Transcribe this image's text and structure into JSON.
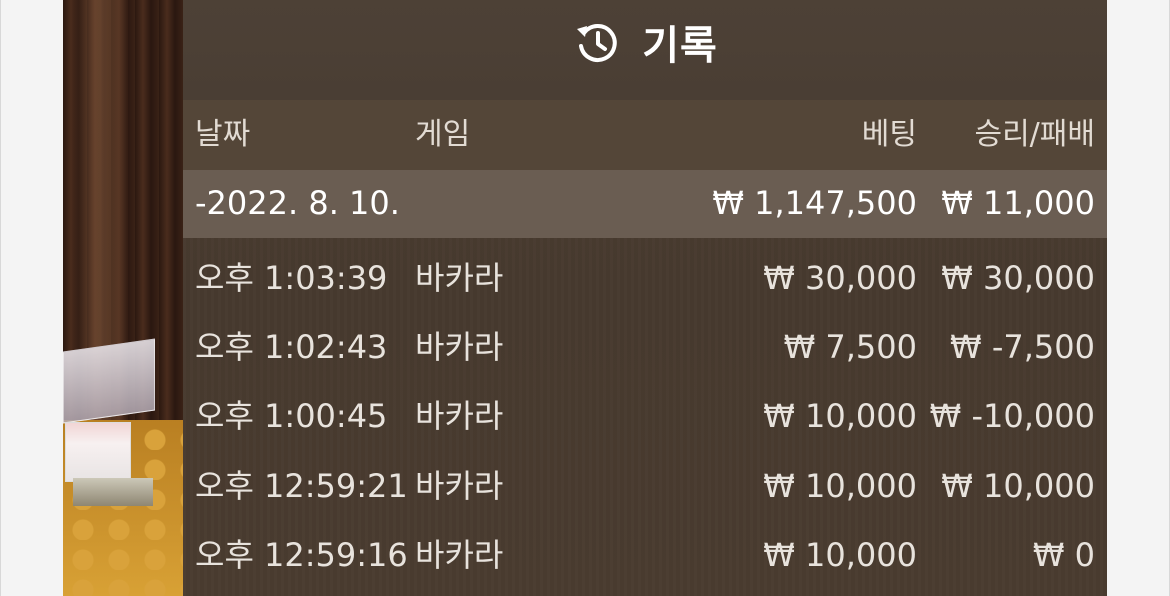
{
  "header": {
    "title": "기록",
    "icon": "history-icon"
  },
  "columns": {
    "date": "날짜",
    "game": "게임",
    "bet": "베팅",
    "result": "승리/패배"
  },
  "summary": {
    "date": "-2022. 8. 10.",
    "bet": "₩ 1,147,500",
    "result": "₩ 11,000"
  },
  "rows": [
    {
      "time": "오후 1:03:39",
      "game": "바카라",
      "bet": "₩ 30,000",
      "result": "₩ 30,000"
    },
    {
      "time": "오후 1:02:43",
      "game": "바카라",
      "bet": "₩ 7,500",
      "result": "₩ -7,500"
    },
    {
      "time": "오후 1:00:45",
      "game": "바카라",
      "bet": "₩ 10,000",
      "result": "₩ -10,000"
    },
    {
      "time": "오후 12:59:21",
      "game": "바카라",
      "bet": "₩ 10,000",
      "result": "₩ 10,000"
    },
    {
      "time": "오후 12:59:16",
      "game": "바카라",
      "bet": "₩ 10,000",
      "result": "₩ 0"
    }
  ],
  "colors": {
    "panel": "#4a3c30",
    "summary_row": "#6a5d52",
    "text": "#e8e3dd"
  }
}
